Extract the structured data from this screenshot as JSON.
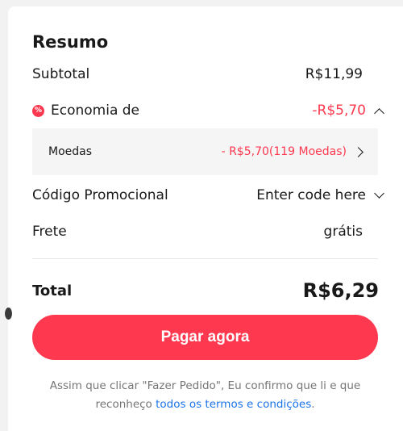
{
  "summary": {
    "title": "Resumo",
    "subtotal_label": "Subtotal",
    "subtotal_value": "R$11,99",
    "savings_icon": "discount-badge-icon",
    "savings_icon_glyph": "%",
    "savings_label": "Economia de",
    "savings_value": "-R$5,70",
    "coins_label": "Moedas",
    "coins_value": "- R$5,70(119 Moedas)",
    "promo_label": "Código Promocional",
    "promo_value": "Enter code here",
    "shipping_label": "Frete",
    "shipping_value": "grátis",
    "total_label": "Total",
    "total_value": "R$6,29"
  },
  "checkout": {
    "pay_button_label": "Pagar agora",
    "terms_text": "Assim que clicar \"Fazer Pedido\", Eu confirmo que li e que reconheço ",
    "terms_link": "todos os termos e condições",
    "terms_end": "."
  },
  "colors": {
    "accent": "#fd384f",
    "link": "#1a73e8",
    "muted_text": "#757575"
  }
}
